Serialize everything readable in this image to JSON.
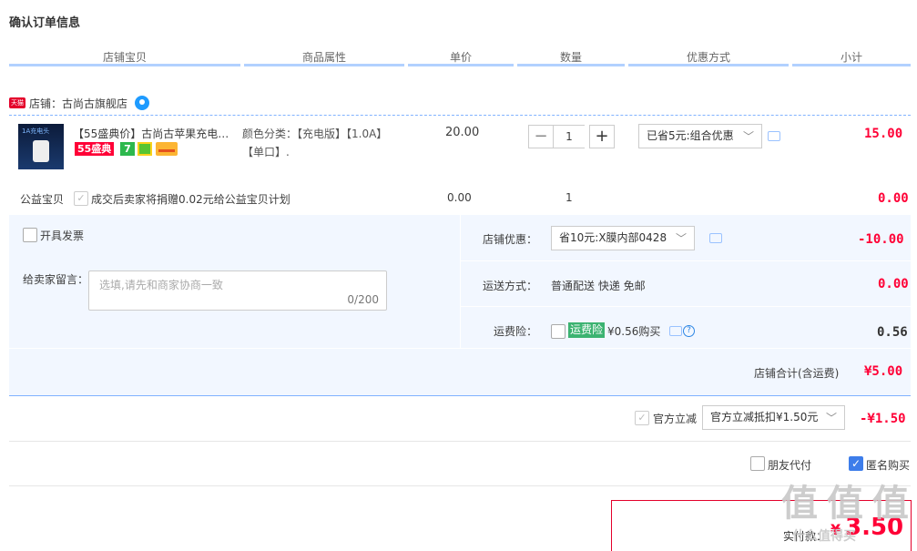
{
  "page": {
    "title": "确认订单信息"
  },
  "columns": [
    "店铺宝贝",
    "商品属性",
    "单价",
    "数量",
    "优惠方式",
    "小计"
  ],
  "shop": {
    "label": "店铺：古尚古旗舰店",
    "tmall_badge": "天猫"
  },
  "item": {
    "title": "【55盛典价】古尚古苹果充电…",
    "promo_badge": "55盛典",
    "badge7": "7",
    "image_caption": "1A充电头",
    "attr_line1": "颜色分类：【充电版】【1.0A】",
    "attr_line2": "【单口】.",
    "unit_price": "20.00",
    "quantity": "1",
    "minus": "−",
    "plus": "+",
    "discount": "已省5元:组合优惠",
    "subtotal": "15.00"
  },
  "charity": {
    "label": "公益宝贝",
    "text": "成交后卖家将捐赠0.02元给公益宝贝计划",
    "price": "0.00",
    "qty": "1",
    "subtotal": "0.00"
  },
  "invoice": {
    "label": "开具发票"
  },
  "message": {
    "label": "给卖家留言：",
    "placeholder": "选填,请先和商家协商一致",
    "counter": "0/200"
  },
  "shop_coupon": {
    "label": "店铺优惠：",
    "value": "省10元:X膜内部0428",
    "amount": "-10.00"
  },
  "shipping": {
    "label": "运送方式：",
    "value": "普通配送 快递 免邮",
    "amount": "0.00"
  },
  "insurance": {
    "label": "运费险：",
    "tag": "运费险",
    "text": "¥0.56购买",
    "amount": "0.56",
    "help": "?"
  },
  "shop_total": {
    "label": "店铺合计(含运费)",
    "amount": "¥5.00"
  },
  "official": {
    "label": "官方立减",
    "select": "官方立减抵扣¥1.50元",
    "amount": "-¥1.50"
  },
  "options": {
    "friend_pay": "朋友代付",
    "anonymous": "匿名购买"
  },
  "payment": {
    "label": "实付款：",
    "currency": "¥",
    "amount": "3.50"
  },
  "watermark": {
    "text": "值 值 值",
    "site": "什么值得买"
  },
  "colors": {
    "accent_red": "#ff0036",
    "header_line": "#b2d1ff",
    "panel_bg": "#f2f7ff"
  },
  "icons": [
    "wangwang-icon",
    "message-icon",
    "help-icon",
    "chevron-down-icon",
    "check-icon"
  ]
}
